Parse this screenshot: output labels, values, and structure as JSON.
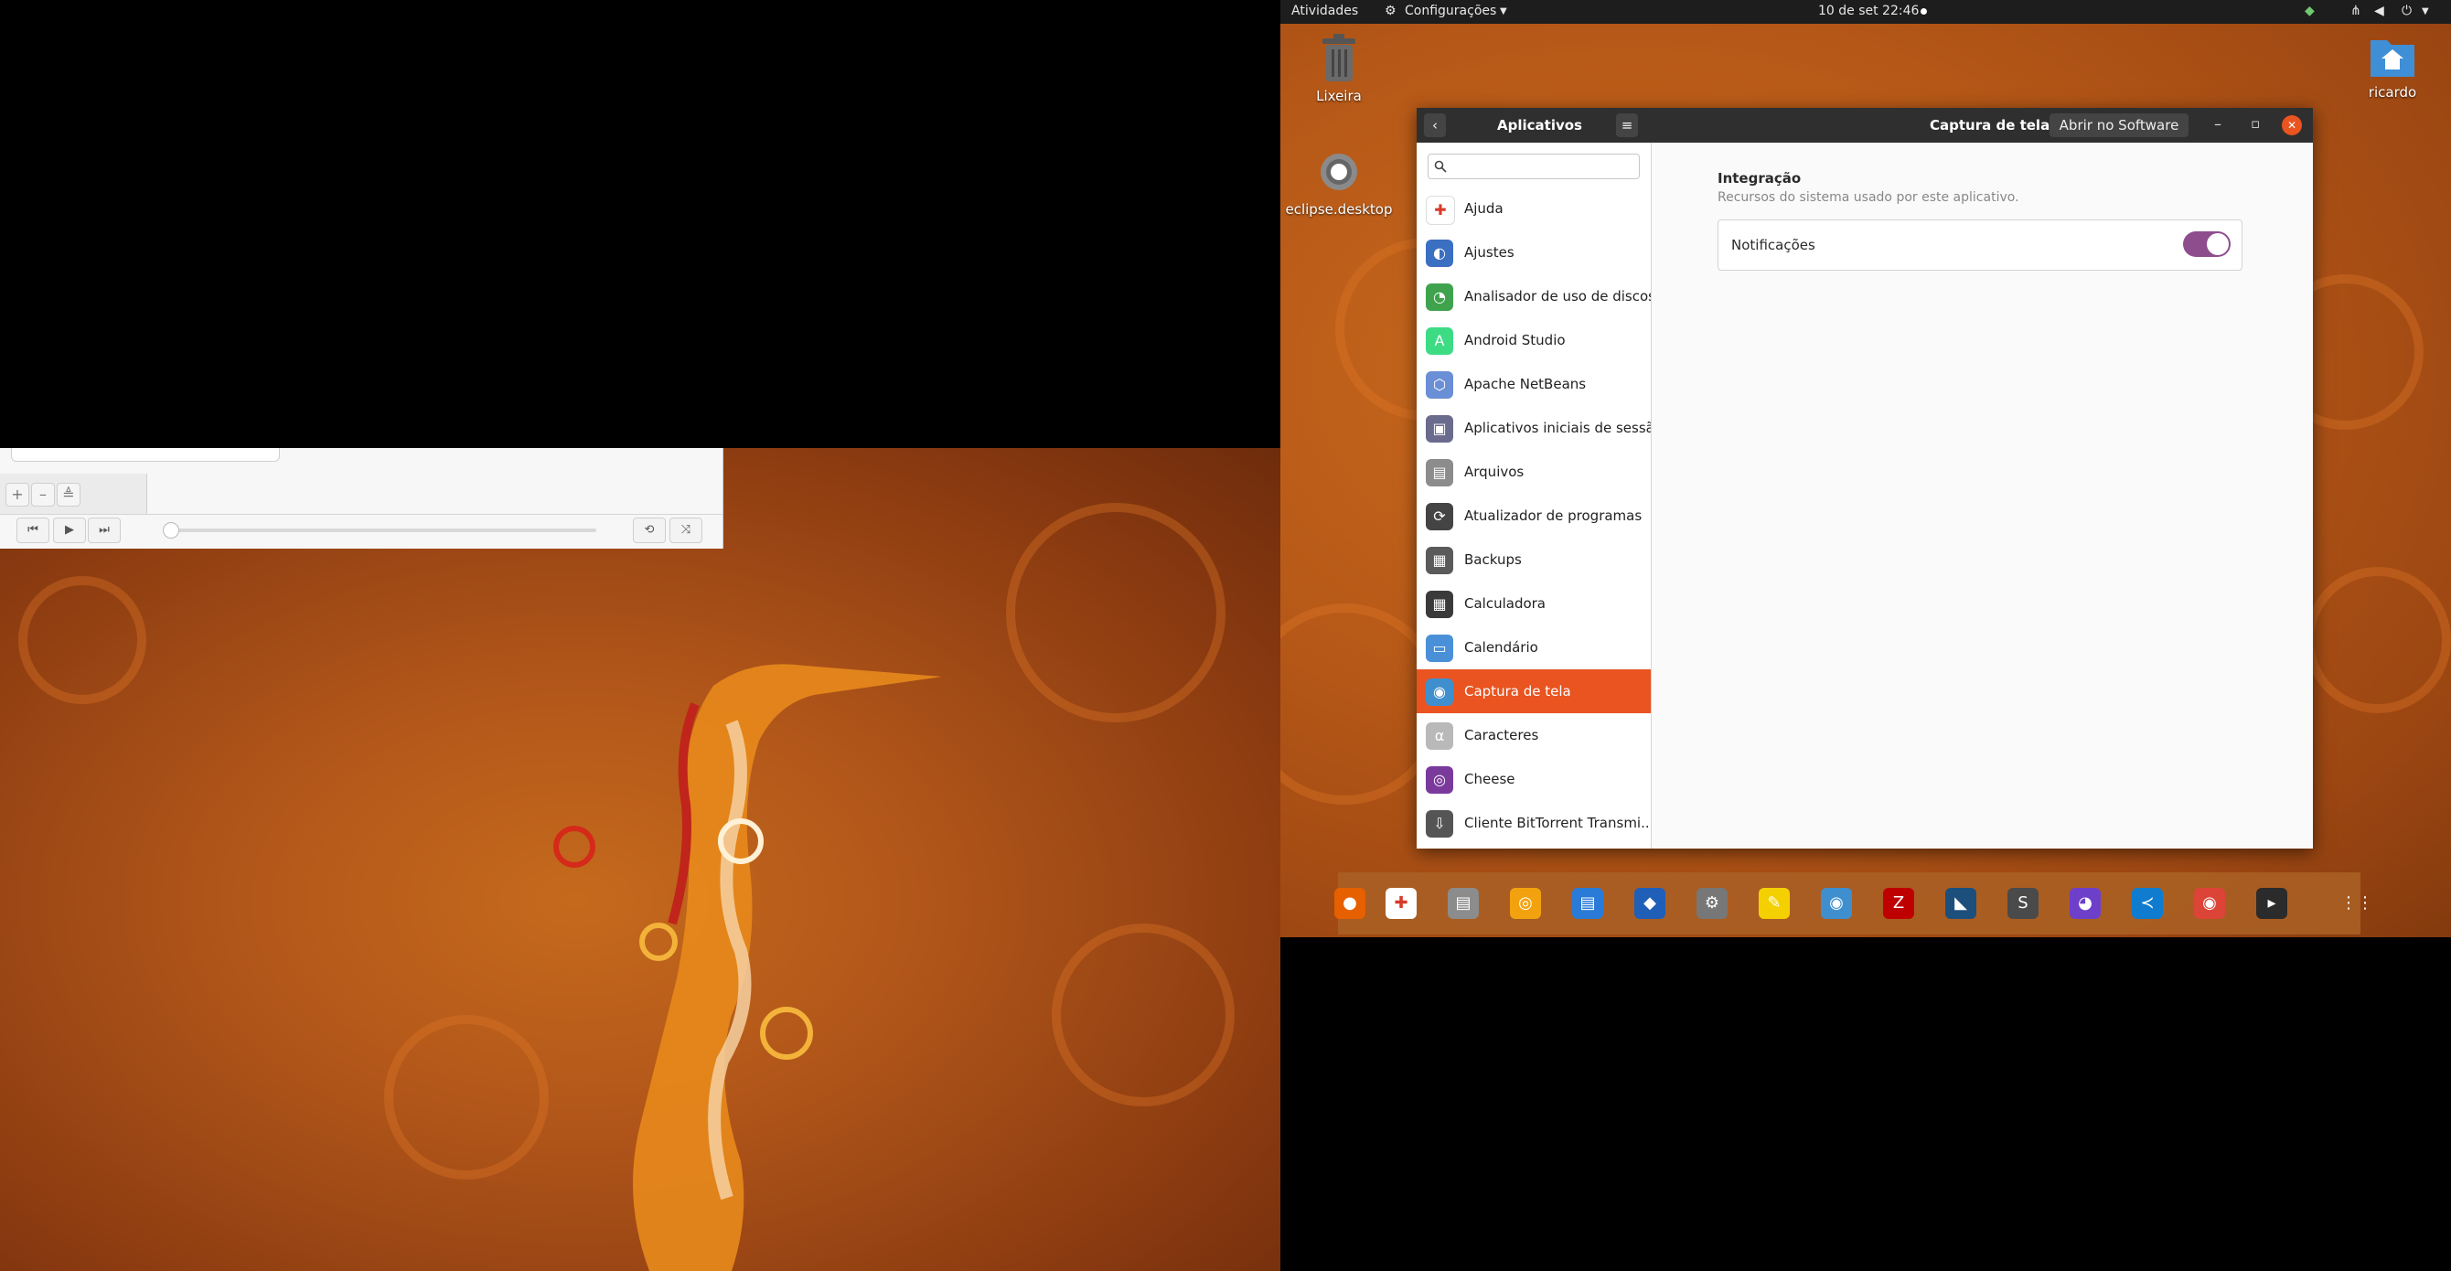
{
  "topbar": {
    "activities": "Atividades",
    "app_menu": "Configurações",
    "clock": "10 de set  22:46"
  },
  "desktop": {
    "trash": "Lixeira",
    "eclipse": "eclipse.desktop",
    "home": "ricardo"
  },
  "player": {
    "add": "+",
    "remove": "–",
    "eject": "≜",
    "prev": "⏮",
    "play": "▶",
    "next": "⏭",
    "repeat": "⟲",
    "shuffle": "⤨"
  },
  "window": {
    "sidebar_title": "Aplicativos",
    "title": "Captura de tela",
    "open_in_software": "Abrir no Software",
    "back": "‹",
    "menu": "≡",
    "minimize": "–",
    "maximize": "▫",
    "close": "✕"
  },
  "apps": [
    {
      "label": "Ajuda",
      "color": "#ffffff",
      "glyph": "✚",
      "selected": false
    },
    {
      "label": "Ajustes",
      "color": "#3b6fc2",
      "glyph": "◐",
      "selected": false
    },
    {
      "label": "Analisador de uso de discos",
      "color": "#3fa34d",
      "glyph": "◔",
      "selected": false
    },
    {
      "label": "Android Studio",
      "color": "#3ddc84",
      "glyph": "A",
      "selected": false
    },
    {
      "label": "Apache NetBeans",
      "color": "#6b8fd6",
      "glyph": "⬡",
      "selected": false
    },
    {
      "label": "Aplicativos iniciais de sessão",
      "color": "#6b6b8e",
      "glyph": "▣",
      "selected": false
    },
    {
      "label": "Arquivos",
      "color": "#8c8c8c",
      "glyph": "▤",
      "selected": false
    },
    {
      "label": "Atualizador de programas",
      "color": "#444444",
      "glyph": "⟳",
      "selected": false
    },
    {
      "label": "Backups",
      "color": "#5a5a5a",
      "glyph": "▦",
      "selected": false
    },
    {
      "label": "Calculadora",
      "color": "#3a3a3a",
      "glyph": "▦",
      "selected": false
    },
    {
      "label": "Calendário",
      "color": "#4a90d9",
      "glyph": "▭",
      "selected": false
    },
    {
      "label": "Captura de tela",
      "color": "#3f8fce",
      "glyph": "◉",
      "selected": true
    },
    {
      "label": "Caracteres",
      "color": "#b9b9b9",
      "glyph": "α",
      "selected": false
    },
    {
      "label": "Cheese",
      "color": "#7a3a9c",
      "glyph": "◎",
      "selected": false
    },
    {
      "label": "Cliente BitTorrent Transmi...",
      "color": "#555555",
      "glyph": "⇩",
      "selected": false
    }
  ],
  "content": {
    "section_title": "Integração",
    "section_desc": "Recursos do sistema usado por este aplicativo.",
    "notifications_label": "Notificações",
    "notifications_on": true
  },
  "dock": [
    {
      "name": "firefox-icon",
      "color": "#e66000",
      "glyph": "●"
    },
    {
      "name": "help-icon",
      "color": "#ffffff",
      "glyph": "✚"
    },
    {
      "name": "files-icon",
      "color": "#8c8c8c",
      "glyph": "▤"
    },
    {
      "name": "rhythmbox-icon",
      "color": "#f3a20f",
      "glyph": "◎"
    },
    {
      "name": "writer-icon",
      "color": "#2a7bd8",
      "glyph": "▤"
    },
    {
      "name": "inkscape-icon",
      "color": "#1f5fb8",
      "glyph": "◆"
    },
    {
      "name": "settings-icon",
      "color": "#777777",
      "glyph": "⚙"
    },
    {
      "name": "notes-icon",
      "color": "#f5d000",
      "glyph": "✎"
    },
    {
      "name": "screenshot-icon",
      "color": "#3f8fce",
      "glyph": "◉"
    },
    {
      "name": "filezilla-icon",
      "color": "#bf0000",
      "glyph": "Z"
    },
    {
      "name": "mysql-workbench-icon",
      "color": "#1c4f7c",
      "glyph": "◣"
    },
    {
      "name": "sublime-icon",
      "color": "#4a4a4a",
      "glyph": "S"
    },
    {
      "name": "github-icon",
      "color": "#6e40c9",
      "glyph": "◕"
    },
    {
      "name": "vscode-icon",
      "color": "#0f7ccf",
      "glyph": "≺"
    },
    {
      "name": "chrome-icon",
      "color": "#db4437",
      "glyph": "◉"
    },
    {
      "name": "terminal-icon",
      "color": "#2b2b2b",
      "glyph": "▸"
    },
    {
      "name": "show-apps-icon",
      "color": "transparent",
      "glyph": "⋮⋮"
    }
  ]
}
